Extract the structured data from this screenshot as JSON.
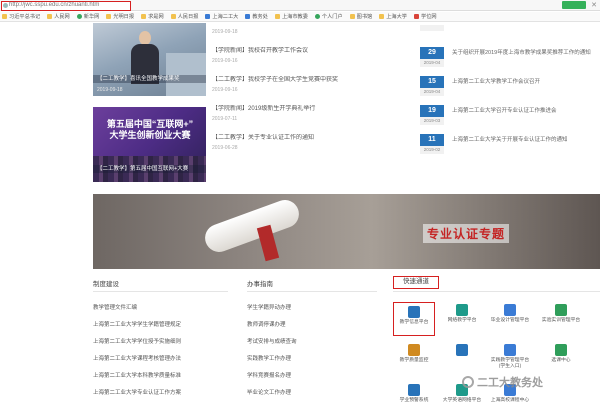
{
  "browser": {
    "url": "http://jwc.sspu.edu.cn/zhuanti.htm",
    "go_label": "",
    "close_glyph": "✕"
  },
  "bookmarks": [
    {
      "label": "习近平总书记",
      "icon": "folder"
    },
    {
      "label": "人民网",
      "icon": "folder"
    },
    {
      "label": "新华网",
      "icon": "green"
    },
    {
      "label": "光明日报",
      "icon": "folder"
    },
    {
      "label": "求是网",
      "icon": "folder"
    },
    {
      "label": "人民日报",
      "icon": "folder"
    },
    {
      "label": "上海二工大",
      "icon": "blue"
    },
    {
      "label": "教务处",
      "icon": "blue"
    },
    {
      "label": "上海市教委",
      "icon": "folder"
    },
    {
      "label": "个人门户",
      "icon": "green"
    },
    {
      "label": "图书馆",
      "icon": "folder"
    },
    {
      "label": "上海大学",
      "icon": "folder"
    },
    {
      "label": "学位网",
      "icon": "red"
    }
  ],
  "image_news": [
    {
      "caption": "【二工教学】喜讯全国教学成果奖",
      "date": "2019-09-18"
    },
    {
      "caption": "【二工教学】第五届中国互联网+大赛",
      "date": ""
    }
  ],
  "banner_big_text": [
    "第五届中国“互联网+”",
    "大学生创新创业大赛"
  ],
  "mid_news": [
    {
      "title": "",
      "date": "2019-09-18"
    },
    {
      "title": "【学院新闻】我校召开教学工作会议",
      "date": "2019-09-16"
    },
    {
      "title": "【二工教学】我校学子在全国大学生竞赛中获奖",
      "date": "2019-09-16"
    },
    {
      "title": "【学院新闻】2019级新生开学典礼举行",
      "date": "2019-07-11"
    },
    {
      "title": "【二工教学】关于专业认证工作的通知",
      "date": "2019-06-28"
    }
  ],
  "date_news": [
    {
      "day": "29",
      "ym": "2019-04",
      "text": "关于组织开展2019年度上海市教学成果奖推荐工作的通知"
    },
    {
      "day": "15",
      "ym": "2019-04",
      "text": "上海第二工业大学教学工作会议召开"
    },
    {
      "day": "19",
      "ym": "2019-03",
      "text": "上海第二工业大学召开专业认证工作推进会"
    },
    {
      "day": "11",
      "ym": "2019-02",
      "text": "上海第二工业大学关于开展专业认证工作的通知"
    }
  ],
  "banner_title": "专业认证专题",
  "columns": [
    {
      "heading": "制度建设",
      "items": [
        "教学管理文件汇编",
        "上海第二工业大学学生学籍管理规定",
        "上海第二工业大学学位授予实施细则",
        "上海第二工业大学课程考核管理办法",
        "上海第二工业大学本科教学质量标准",
        "上海第二工业大学专业认证工作方案"
      ]
    },
    {
      "heading": "办事指南",
      "items": [
        "学生学籍异动办理",
        "教师调停课办理",
        "考试安排与成绩查询",
        "实践教学工作办理",
        "学科竞赛报名办理",
        "毕业论文工作办理"
      ]
    }
  ],
  "quick_links": {
    "heading": "快速通道",
    "items": [
      {
        "label": "教学信息平台",
        "color": "#2873b9",
        "active": true
      },
      {
        "label": "网络教学平台",
        "color": "#1e9a8a",
        "active": false
      },
      {
        "label": "毕业设计管理平台",
        "color": "#3a7bd5",
        "active": false
      },
      {
        "label": "实验实训管理平台",
        "color": "#2f9e5a",
        "active": false
      },
      {
        "label": "教学质量监控",
        "color": "#d08a20",
        "active": false
      },
      {
        "label": "",
        "color": "#2873b9",
        "active": false
      },
      {
        "label": "实践教学管理平台(学生入口)",
        "color": "#3a7bd5",
        "active": false
      },
      {
        "label": "选课中心",
        "color": "#2f9e5a",
        "active": false
      },
      {
        "label": "学业预警系统",
        "color": "#2873b9",
        "active": false
      },
      {
        "label": "大学英语网络平台",
        "color": "#1e9a8a",
        "active": false
      },
      {
        "label": "上海高校课程中心",
        "color": "#3a7bd5",
        "active": false
      },
      {
        "label": "二工大教务处",
        "color": "#d08a20",
        "active": false
      },
      {
        "label": "",
        "color": "#2f9e5a",
        "active": false
      }
    ]
  },
  "watermark": "二工大教务处"
}
